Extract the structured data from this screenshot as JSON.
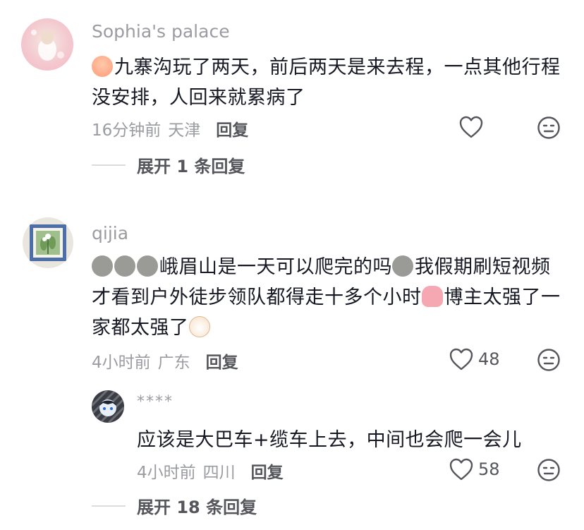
{
  "comments": [
    {
      "username": "Sophia's palace",
      "text": "九寨沟玩了两天，前后两天是来去程，一点其他行程没安排，人回来就累病了",
      "time": "16分钟前",
      "location": "天津",
      "reply_label": "回复",
      "like_count": "",
      "expand_label": "展开 1 条回复"
    },
    {
      "username": "qijia",
      "text_segments": [
        "峨眉山是一天可以爬完的吗",
        "我假期刷短视频才看到户外徒步领队都得走十多个小时",
        "博主太强了一家都太强了"
      ],
      "time": "4小时前",
      "location": "广东",
      "reply_label": "回复",
      "like_count": "48",
      "reply": {
        "username": "****",
        "text": "应该是大巴车+缆车上去，中间也会爬一会儿",
        "time": "4小时前",
        "location": "四川",
        "reply_label": "回复",
        "like_count": "58"
      },
      "expand_label": "展开 18 条回复"
    }
  ],
  "icons": {
    "like": "heart-outline-icon",
    "dislike": "meh-face-icon"
  },
  "colors": {
    "meta": "#9b9ca1",
    "reply": "#55565c",
    "text": "#161823"
  }
}
